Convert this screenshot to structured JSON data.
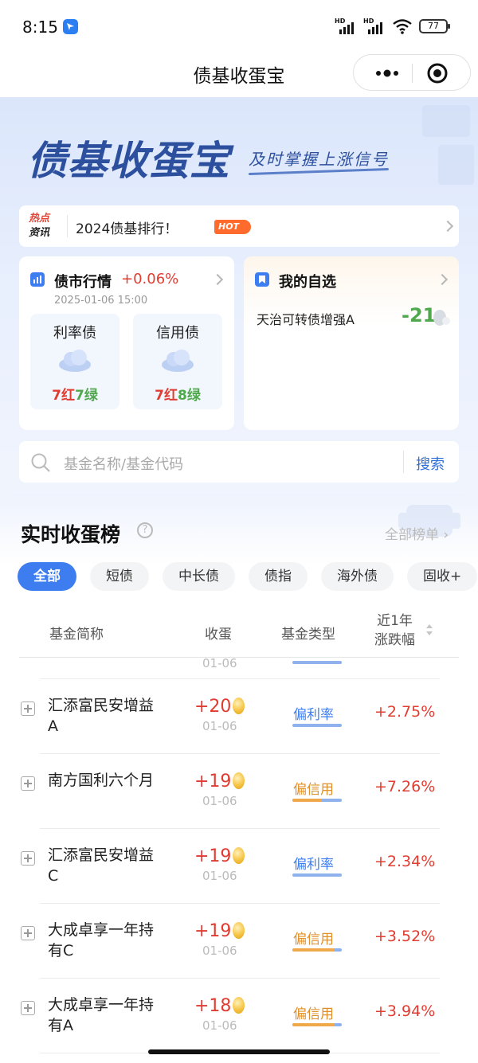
{
  "status": {
    "time": "8:15",
    "hd1": "HD",
    "hd2": "HD",
    "battery": "77"
  },
  "nav": {
    "title": "债基收蛋宝"
  },
  "hero": {
    "brand": "债基收蛋宝",
    "slogan": "及时掌握上涨信号"
  },
  "news": {
    "tag_top": "热点",
    "tag_bottom": "资讯",
    "text": "2024债基排行！",
    "badge": "HOT"
  },
  "market": {
    "title": "债市行情",
    "change": "+0.06%",
    "date": "2025-01-06 15:00",
    "boxes": [
      {
        "label": "利率债",
        "red": "7红",
        "green": "7绿"
      },
      {
        "label": "信用债",
        "red": "7红",
        "green": "8绿"
      }
    ]
  },
  "favorites": {
    "title": "我的自选",
    "fund_name": "天治可转债增强A",
    "value": "-21"
  },
  "search": {
    "placeholder": "基金名称/基金代码",
    "button": "搜索"
  },
  "ranking": {
    "title": "实时收蛋榜",
    "help": "?",
    "all_list": "全部榜单 ›",
    "tabs": [
      "全部",
      "短债",
      "中长债",
      "债指",
      "海外债",
      "固收+"
    ],
    "headers": {
      "name": "基金简称",
      "egg": "收蛋",
      "type": "基金类型",
      "change_line1": "近1年",
      "change_line2": "涨跌幅"
    },
    "partial_date": "01-06",
    "rows": [
      {
        "name": "汇添富民安增益A",
        "egg": "+20",
        "date": "01-06",
        "type": "偏利率",
        "type_kind": "rate",
        "credit_share": 0,
        "change": "+2.75%"
      },
      {
        "name": "南方国利六个月",
        "egg": "+19",
        "date": "01-06",
        "type": "偏信用",
        "type_kind": "credit",
        "credit_share": 0.6,
        "change": "+7.26%"
      },
      {
        "name": "汇添富民安增益C",
        "egg": "+19",
        "date": "01-06",
        "type": "偏利率",
        "type_kind": "rate",
        "credit_share": 0,
        "change": "+2.34%"
      },
      {
        "name": "大成卓享一年持有C",
        "egg": "+19",
        "date": "01-06",
        "type": "偏信用",
        "type_kind": "credit",
        "credit_share": 0.85,
        "change": "+3.52%"
      },
      {
        "name": "大成卓享一年持有A",
        "egg": "+18",
        "date": "01-06",
        "type": "偏信用",
        "type_kind": "credit",
        "credit_share": 0.85,
        "change": "+3.94%"
      }
    ]
  }
}
